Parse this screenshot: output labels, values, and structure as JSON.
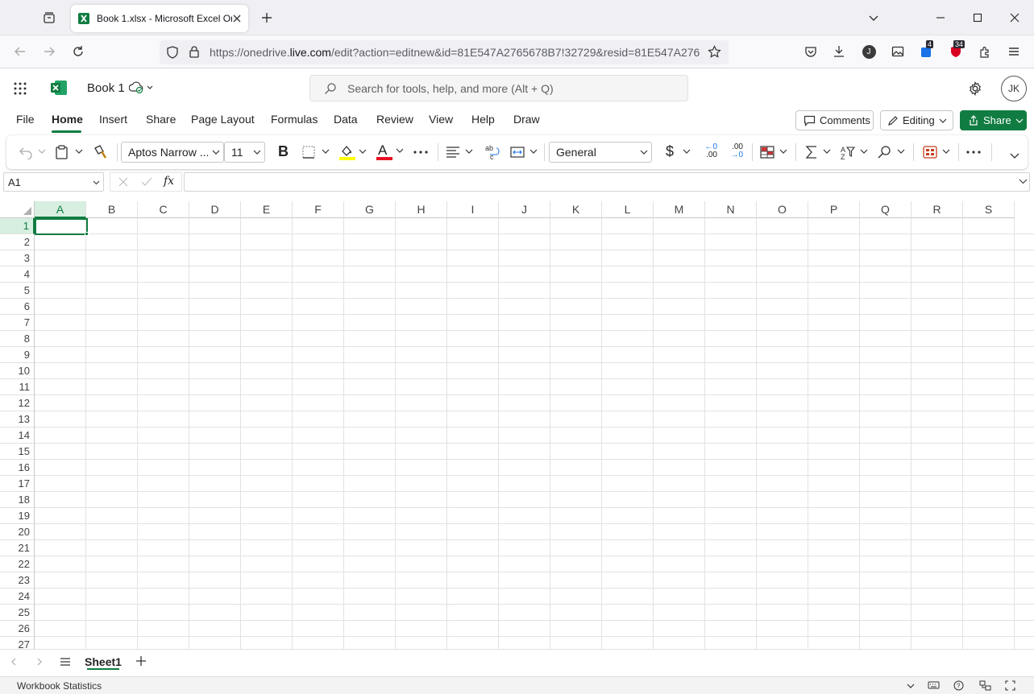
{
  "browser": {
    "tab_title": "Book 1.xlsx - Microsoft Excel Or",
    "url_prefix": "https://onedrive.",
    "url_domain": "live.com",
    "url_rest": "/edit?action=editnew&id=81E547A2765678B7!32729&resid=81E547A276",
    "ext_badge_1": "4",
    "ext_badge_2": "34",
    "profile_letter": "J"
  },
  "app": {
    "doc_title": "Book 1",
    "search_placeholder": "Search for tools, help, and more (Alt + Q)",
    "avatar_initials": "JK",
    "brand_color": "#107c41"
  },
  "menu": {
    "tabs": [
      "File",
      "Home",
      "Insert",
      "Share",
      "Page Layout",
      "Formulas",
      "Data",
      "Review",
      "View",
      "Help",
      "Draw"
    ],
    "active": "Home",
    "comments_label": "Comments",
    "editing_label": "Editing",
    "share_label": "Share"
  },
  "ribbon": {
    "font_name": "Aptos Narrow ...",
    "font_size": "11",
    "bold_label": "B",
    "font_color_label": "A",
    "number_format": "General",
    "currency_label": "$",
    "decrease_decimal_top": "←0",
    "decrease_decimal_bottom": ".00",
    "increase_decimal_top": ".00",
    "increase_decimal_bottom": "→0",
    "font_color_bar": "#e81123",
    "highlight_color_bar": "#ffff00"
  },
  "formula_bar": {
    "name_box": "A1",
    "fx_label": "fx",
    "formula": ""
  },
  "grid": {
    "columns": [
      "A",
      "B",
      "C",
      "D",
      "E",
      "F",
      "G",
      "H",
      "I",
      "J",
      "K",
      "L",
      "M",
      "N",
      "O",
      "P",
      "Q",
      "R",
      "S"
    ],
    "rows": [
      "1",
      "2",
      "3",
      "4",
      "5",
      "6",
      "7",
      "8",
      "9",
      "10",
      "11",
      "12",
      "13",
      "14",
      "15",
      "16",
      "17",
      "18",
      "19",
      "20",
      "21",
      "22",
      "23",
      "24",
      "25",
      "26",
      "27"
    ],
    "active_cell": "A1"
  },
  "sheets": {
    "tabs": [
      "Sheet1"
    ],
    "active": "Sheet1"
  },
  "status": {
    "left_text": "Workbook Statistics"
  }
}
